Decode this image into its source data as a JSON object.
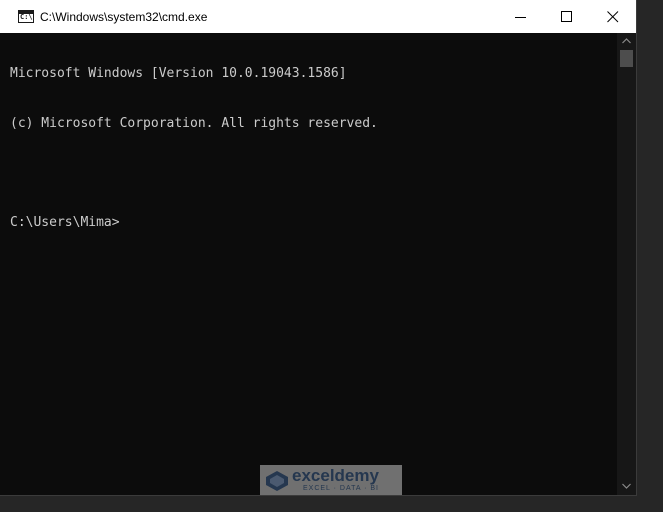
{
  "window": {
    "title": "C:\\Windows\\system32\\cmd.exe",
    "icon": "cmd-icon",
    "icon_glyph": "C:\\",
    "controls": [
      "minimize-icon",
      "maximize-icon",
      "close-icon"
    ]
  },
  "console": {
    "lines": [
      "Microsoft Windows [Version 10.0.19043.1586]",
      "(c) Microsoft Corporation. All rights reserved.",
      "",
      "C:\\Users\\Mima>"
    ],
    "foreground": "#cccccc",
    "background": "#0c0c0c"
  },
  "scrollbar": {
    "position": 0
  },
  "watermark": {
    "name": "exceldemy",
    "tagline": "EXCEL · DATA · BI"
  }
}
